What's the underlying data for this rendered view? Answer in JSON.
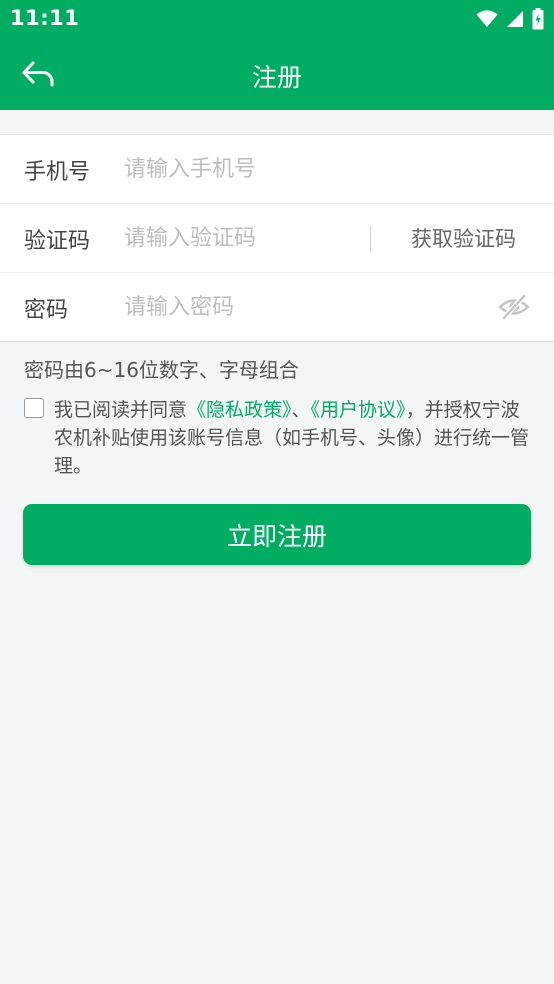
{
  "status_bar": {
    "time": "11:11"
  },
  "header": {
    "title": "注册",
    "back_icon": "back-arrow-icon"
  },
  "form": {
    "phone": {
      "label": "手机号",
      "placeholder": "请输入手机号",
      "value": ""
    },
    "code": {
      "label": "验证码",
      "placeholder": "请输入验证码",
      "value": "",
      "button_label": "获取验证码"
    },
    "password": {
      "label": "密码",
      "placeholder": "请输入密码",
      "value": "",
      "toggle_icon": "eye-hidden-icon"
    }
  },
  "password_hint": "密码由6~16位数字、字母组合",
  "agreement": {
    "checked": false,
    "prefix": "我已阅读并同意",
    "privacy_link": "《隐私政策》",
    "separator": "、",
    "terms_link": "《用户协议》",
    "suffix": "，并授权宁波农机补贴使用该账号信息（如手机号、头像）进行统一管理。"
  },
  "submit_label": "立即注册",
  "colors": {
    "brand": "#00ad62",
    "background": "#f4f5f7",
    "hint_text": "#555555"
  }
}
